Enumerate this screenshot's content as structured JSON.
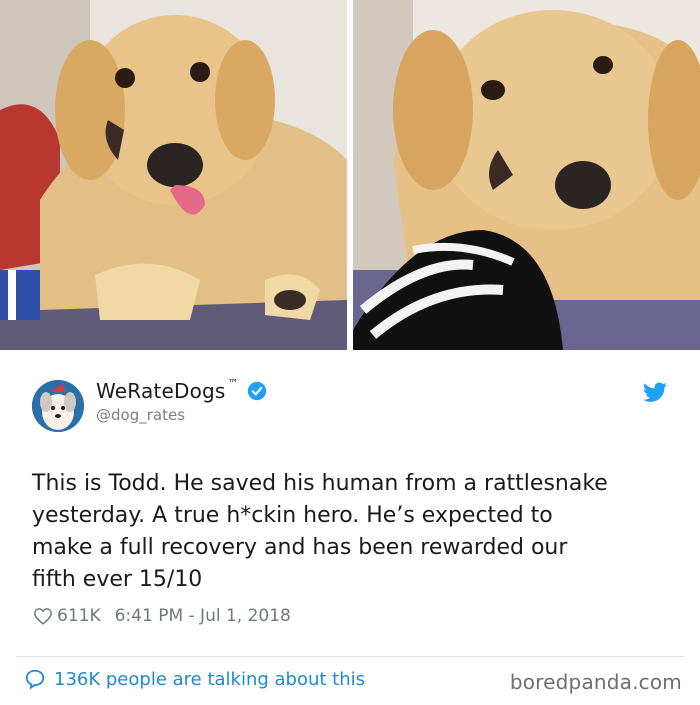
{
  "photos": [
    {
      "subject": "golden retriever puppy with tongue out"
    },
    {
      "subject": "golden retriever puppy lying on zebra pillow"
    }
  ],
  "tweet": {
    "author_name": "WeRateDogs",
    "trademark": "™",
    "handle": "@dog_rates",
    "text": "This is Todd. He saved his human from a rattlesnake\nyesterday. A true h*ckin hero. He’s expected to\nmake a full recovery and has been rewarded our\nfifth ever 15/10",
    "likes": "611K",
    "timestamp": "6:41 PM - Jul 1, 2018",
    "talking": "136K people are talking about this"
  },
  "watermark": "boredpanda.com",
  "colors": {
    "accent_blue": "#1d8ad6",
    "verified_blue": "#1da1f2",
    "text": "#1b1b1b",
    "muted": "#71787f"
  },
  "icons": [
    "verified-badge-icon",
    "twitter-bird-icon",
    "heart-icon",
    "speech-bubble-icon"
  ]
}
